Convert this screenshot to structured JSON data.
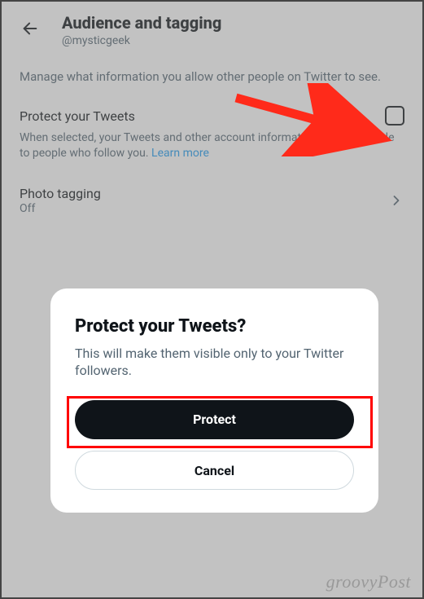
{
  "header": {
    "title": "Audience and tagging",
    "handle": "@mysticgeek"
  },
  "intro": "Manage what information you allow other people on Twitter to see.",
  "protect": {
    "title": "Protect your Tweets",
    "desc": "When selected, your Tweets and other account information are only visible to people who follow you. ",
    "learn_more": "Learn more"
  },
  "photo_tagging": {
    "title": "Photo tagging",
    "value": "Off"
  },
  "dialog": {
    "title": "Protect your Tweets?",
    "body": "This will make them visible only to your Twitter followers.",
    "primary": "Protect",
    "secondary": "Cancel"
  },
  "watermark": "groovyPost"
}
